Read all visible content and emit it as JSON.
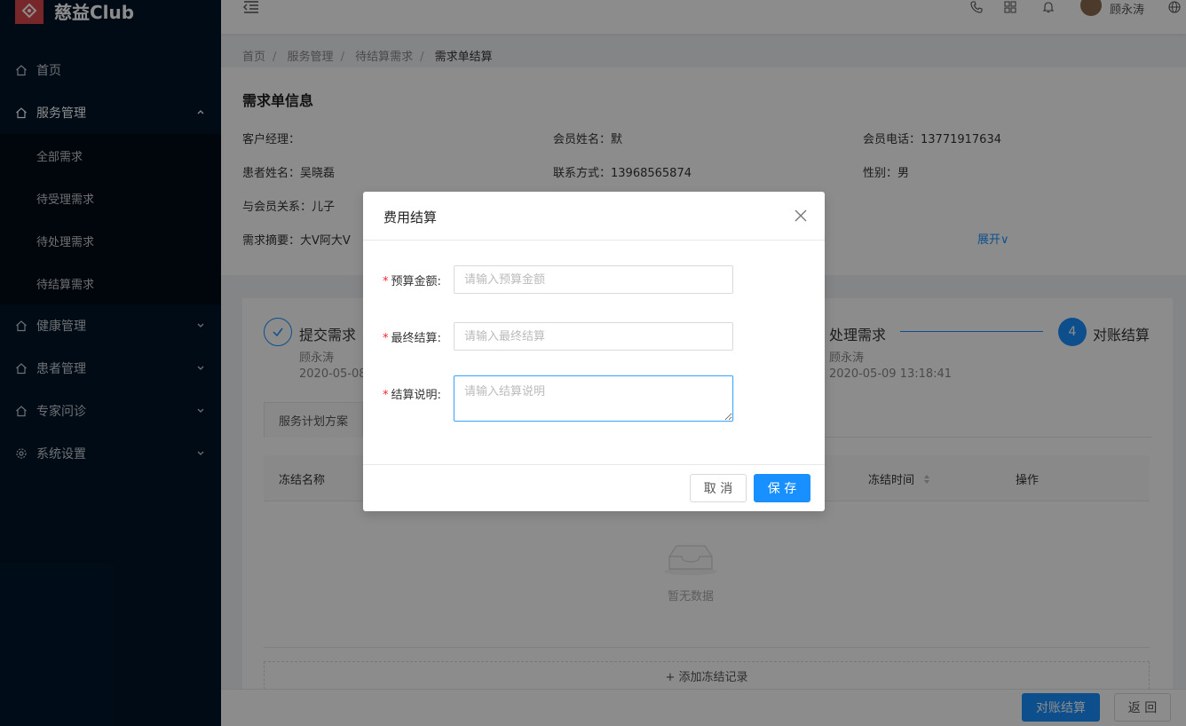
{
  "app": {
    "logo_text": "慈益Club"
  },
  "sidebar": {
    "items": [
      {
        "label": "首页",
        "icon": "home-icon"
      },
      {
        "label": "服务管理",
        "icon": "home-icon",
        "open": true,
        "children": [
          {
            "label": "全部需求"
          },
          {
            "label": "待受理需求"
          },
          {
            "label": "待处理需求"
          },
          {
            "label": "待结算需求"
          }
        ]
      },
      {
        "label": "健康管理",
        "icon": "home-icon"
      },
      {
        "label": "患者管理",
        "icon": "home-icon"
      },
      {
        "label": "专家问诊",
        "icon": "home-icon"
      },
      {
        "label": "系统设置",
        "icon": "gear-icon"
      }
    ]
  },
  "header": {
    "user_name": "顾永涛"
  },
  "breadcrumb": [
    "首页",
    "服务管理",
    "待结算需求",
    "需求单结算"
  ],
  "info": {
    "title": "需求单信息",
    "manager": "客户经理：",
    "member_name": "会员姓名：默",
    "member_phone": "会员电话：13771917634",
    "patient_name": "患者姓名：吴晓磊",
    "contact": "联系方式：13968565874",
    "gender": "性别：男",
    "relation": "与会员关系：儿子",
    "summary": "需求摘要：大V阿大V",
    "expand": "展开∨"
  },
  "steps": {
    "s1_title": "提交需求",
    "s1_user": "顾永涛",
    "s1_time": "2020-05-08",
    "s3_title": "处理需求",
    "s3_user": "顾永涛",
    "s3_time": "2020-05-09 13:18:41",
    "s4_num": "4",
    "s4_title": "对账结算"
  },
  "tabs": {
    "plan": "服务计划方案"
  },
  "table": {
    "col_name": "冻结名称",
    "col_time": "冻结时间",
    "col_action": "操作",
    "empty": "暂无数据",
    "add_record": "+ 添加冻结记录"
  },
  "footer": {
    "reconcile": "对账结算",
    "back": "返 回"
  },
  "modal": {
    "title": "费用结算",
    "budget_label": "预算金额:",
    "budget_placeholder": "请输入预算金额",
    "final_label": "最终结算:",
    "final_placeholder": "请输入最终结算",
    "note_label": "结算说明:",
    "note_placeholder": "请输入结算说明",
    "cancel": "取 消",
    "save": "保 存"
  },
  "colors": {
    "primary": "#1890ff",
    "sidebar_bg": "#001529",
    "logo_red": "#d9454b"
  }
}
